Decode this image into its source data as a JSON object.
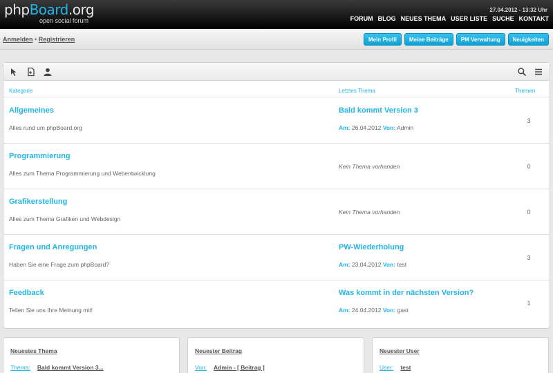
{
  "header": {
    "logo_a": "php",
    "logo_b": "Board",
    "logo_c": ".org",
    "slogan": "open social forum",
    "datetime": "27.04.2012 - 13:32 Uhr",
    "nav": [
      "FORUM",
      "BLOG",
      "NEUES THEMA",
      "USER LISTE",
      "SUCHE",
      "KONTAKT"
    ]
  },
  "subbar": {
    "login": "Anmelden",
    "sep": "•",
    "register": "Registrieren",
    "buttons": [
      "Mein Profil",
      "Meine Beiträge",
      "PM Verwaltung",
      "Neuigkeiten"
    ]
  },
  "toolbar": {
    "icons_left": [
      "cursor-icon",
      "new-document-icon",
      "user-icon"
    ],
    "icons_right": [
      "search-icon",
      "menu-icon"
    ]
  },
  "table": {
    "col_category": "Kategorie",
    "col_last_topic": "Letztes Thema",
    "col_topics": "Themen",
    "rows": [
      {
        "title": "Allgemeines",
        "desc": "Alles rund um phpBoard.org",
        "last_title": "Bald kommt Version 3",
        "am_label": "Am:",
        "date": "26.04.2012",
        "von_label": "Von:",
        "author": "Admin",
        "none": "",
        "count": "3"
      },
      {
        "title": "Programmierung",
        "desc": "Alles zum Thema Programmierung und Webentwicklung",
        "last_title": "",
        "am_label": "",
        "date": "",
        "von_label": "",
        "author": "",
        "none": "Kein Thema vorhanden",
        "count": "0"
      },
      {
        "title": "Grafikerstellung",
        "desc": "Alles zum Thema Grafiken und Webdesign",
        "last_title": "",
        "am_label": "",
        "date": "",
        "von_label": "",
        "author": "",
        "none": "Kein Thema vorhanden",
        "count": "0"
      },
      {
        "title": "Fragen und Anregungen",
        "desc": "Haben Sie eine Frage zum phpBoard?",
        "last_title": "PW-Wiederholung",
        "am_label": "Am:",
        "date": "23.04.2012",
        "von_label": "Von:",
        "author": "test",
        "none": "",
        "count": "3"
      },
      {
        "title": "Feedback",
        "desc": "Teilen Sie uns Ihre Meinung mit!",
        "last_title": "Was kommt in der nächsten Version?",
        "am_label": "Am:",
        "date": "24.04.2012",
        "von_label": "Von:",
        "author": "gast",
        "none": "",
        "count": "1"
      }
    ]
  },
  "boxes": [
    {
      "title": "Neuestes Thema",
      "label": "Thema:",
      "value": "Bald kommt Version 3..."
    },
    {
      "title": "Neuester Beitrag",
      "label": "Von:",
      "value": "Admin - [ Beitrag ]"
    },
    {
      "title": "Neuester User",
      "label": "User:",
      "value": "test"
    }
  ],
  "colors": {
    "accent": "#22b5e6",
    "header_bg": "#111111"
  }
}
